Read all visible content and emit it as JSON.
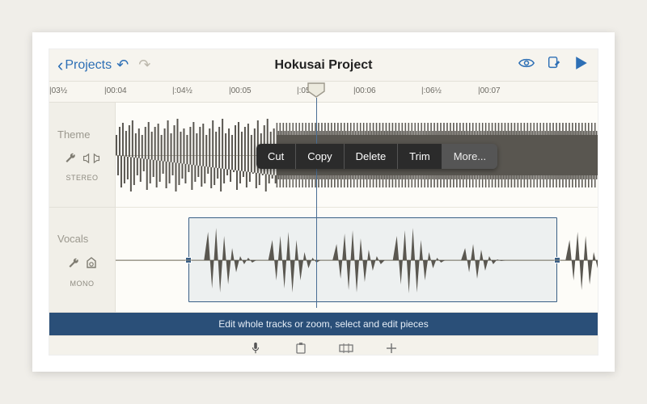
{
  "topbar": {
    "back_label": "Projects",
    "title": "Hokusai Project"
  },
  "ruler": {
    "ticks": [
      {
        "pos": 0,
        "label": "|03½"
      },
      {
        "pos": 68,
        "label": "|00:04"
      },
      {
        "pos": 152,
        "label": "|:04½"
      },
      {
        "pos": 222,
        "label": "|00:05"
      },
      {
        "pos": 306,
        "label": "|:05½"
      },
      {
        "pos": 376,
        "label": "|00:06"
      },
      {
        "pos": 460,
        "label": "|:06½"
      },
      {
        "pos": 530,
        "label": "|00:07"
      }
    ]
  },
  "tracks": [
    {
      "name": "Theme",
      "mode": "STEREO"
    },
    {
      "name": "Vocals",
      "mode": "MONO"
    }
  ],
  "context_menu": {
    "cut": "Cut",
    "copy": "Copy",
    "delete": "Delete",
    "trim": "Trim",
    "more": "More..."
  },
  "hint": "Edit whole tracks or zoom, select and edit pieces"
}
